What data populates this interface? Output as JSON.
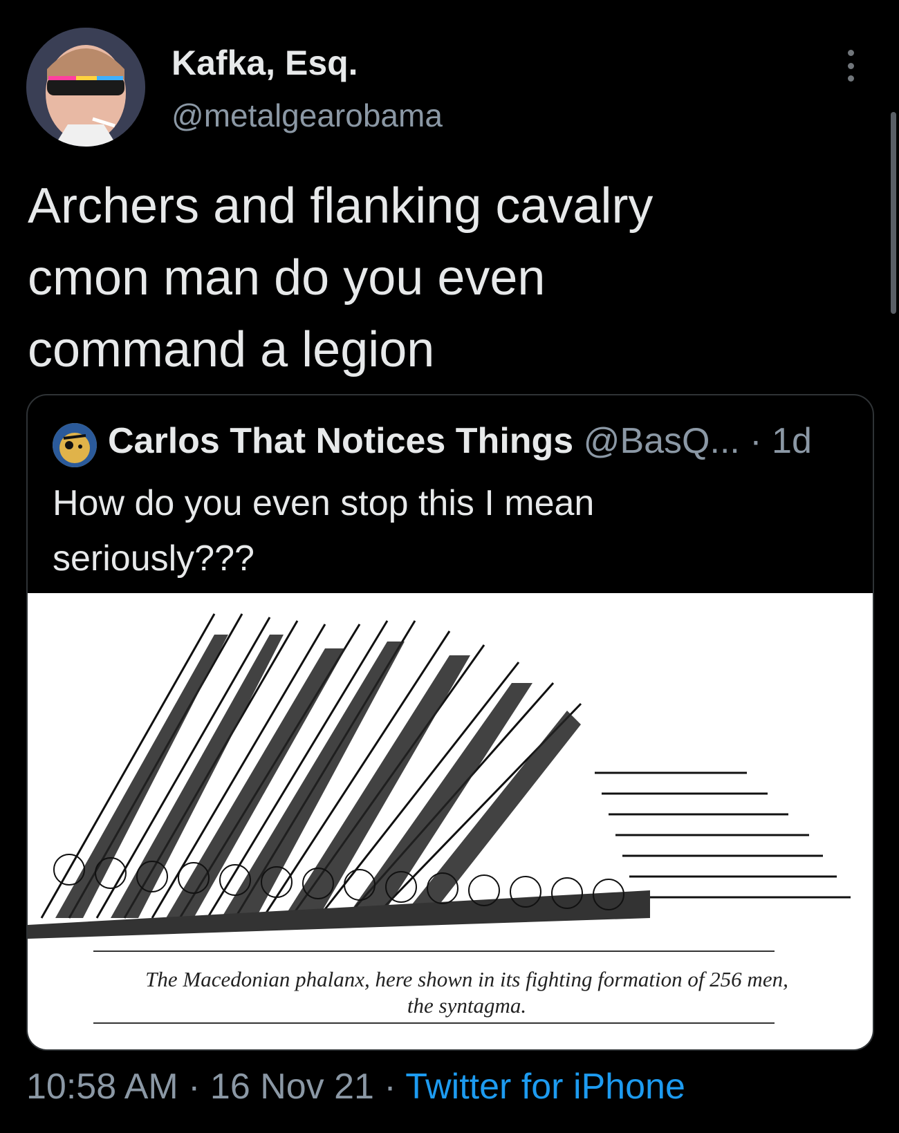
{
  "author": {
    "display_name": "Kafka, Esq.",
    "handle": "@metalgearobama"
  },
  "tweet": {
    "lines": [
      "Archers and flanking cavalry",
      "cmon man do you even",
      "command a legion"
    ]
  },
  "quoted": {
    "display_name": "Carlos That Notices Things",
    "meta": " @BasQ... · 1d",
    "lines": [
      "How do you even stop this I mean",
      "seriously???"
    ],
    "image_caption_lines": [
      "The Macedonian phalanx, here shown in its fighting formation of 256 men,",
      "the syntagma."
    ]
  },
  "footer": {
    "time_date": "10:58 AM · 16 Nov 21 · ",
    "source": "Twitter for iPhone"
  },
  "colors": {
    "background": "#000000",
    "primary_text": "#e7e9ea",
    "secondary_text": "#8b98a5",
    "link": "#1d9bf0"
  },
  "icons": [
    "more-options-icon"
  ]
}
